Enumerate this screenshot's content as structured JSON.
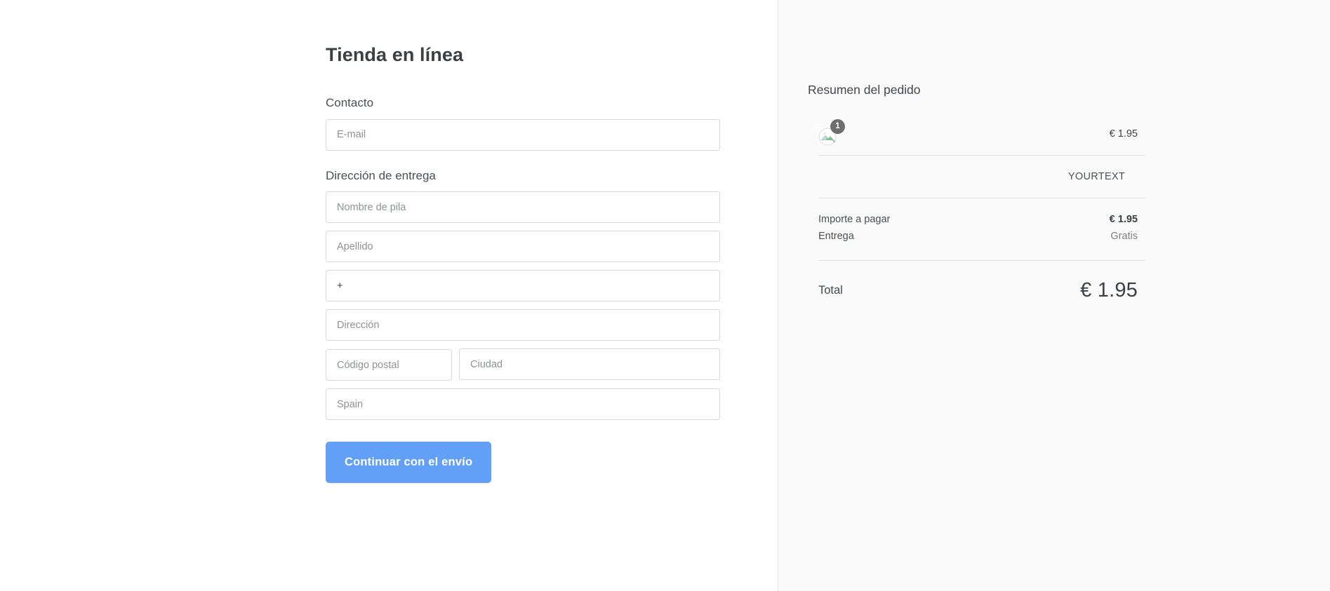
{
  "store": {
    "title": "Tienda en línea"
  },
  "form": {
    "contact": {
      "section_label": "Contacto",
      "email": {
        "value": "",
        "placeholder": "E-mail"
      }
    },
    "shipping": {
      "section_label": "Dirección de entrega",
      "first_name": {
        "value": "",
        "placeholder": "Nombre de pila"
      },
      "last_name": {
        "value": "",
        "placeholder": "Apellido"
      },
      "phone": {
        "value": "+",
        "placeholder": "+"
      },
      "address": {
        "value": "",
        "placeholder": "Dirección"
      },
      "postal_code": {
        "value": "",
        "placeholder": "Código postal"
      },
      "city": {
        "value": "",
        "placeholder": "Ciudad"
      },
      "country": {
        "value": "",
        "placeholder": "Spain"
      }
    },
    "submit_label": "Continuar con el envío"
  },
  "summary": {
    "title": "Resumen del pedido",
    "items": [
      {
        "name": "",
        "quantity": "1",
        "price": "€ 1.95",
        "thumbnail_icon": "broken-image-icon"
      }
    ],
    "promo_text": "YOURTEXT",
    "lines": [
      {
        "label": "Importe a pagar",
        "value": "€ 1.95",
        "muted": false
      },
      {
        "label": "Entrega",
        "value": "Gratis",
        "muted": true
      }
    ],
    "total": {
      "label": "Total",
      "value": "€ 1.95"
    }
  },
  "colors": {
    "accent_button": "#62a0f8",
    "summary_background": "#fafafa",
    "badge": "#6e6e6e",
    "border": "#d8d8d8"
  }
}
